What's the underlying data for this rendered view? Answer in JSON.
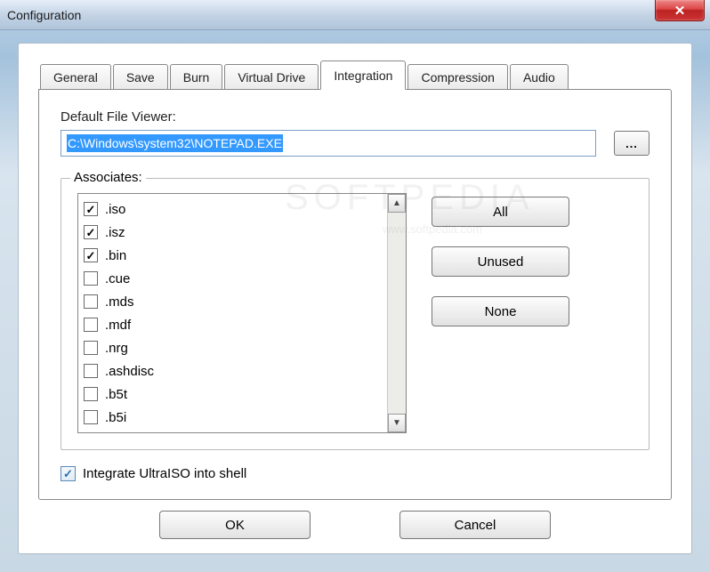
{
  "window": {
    "title": "Configuration",
    "close": "✕"
  },
  "tabs": [
    {
      "label": "General",
      "active": false
    },
    {
      "label": "Save",
      "active": false
    },
    {
      "label": "Burn",
      "active": false
    },
    {
      "label": "Virtual Drive",
      "active": false
    },
    {
      "label": "Integration",
      "active": true
    },
    {
      "label": "Compression",
      "active": false
    },
    {
      "label": "Audio",
      "active": false
    }
  ],
  "integration": {
    "viewer_label": "Default File Viewer:",
    "viewer_value": "C:\\Windows\\system32\\NOTEPAD.EXE",
    "browse_label": "...",
    "associates_label": "Associates:",
    "associates": [
      {
        "ext": ".iso",
        "checked": true
      },
      {
        "ext": ".isz",
        "checked": true
      },
      {
        "ext": ".bin",
        "checked": true
      },
      {
        "ext": ".cue",
        "checked": false
      },
      {
        "ext": ".mds",
        "checked": false
      },
      {
        "ext": ".mdf",
        "checked": false
      },
      {
        "ext": ".nrg",
        "checked": false
      },
      {
        "ext": ".ashdisc",
        "checked": false
      },
      {
        "ext": ".b5t",
        "checked": false
      },
      {
        "ext": ".b5i",
        "checked": false
      }
    ],
    "buttons": {
      "all": "All",
      "unused": "Unused",
      "none": "None"
    },
    "shell_integrate": {
      "label": "Integrate UltraISO into shell",
      "checked": true
    }
  },
  "dialog_buttons": {
    "ok": "OK",
    "cancel": "Cancel"
  },
  "watermark": {
    "main": "SOFTPEDIA",
    "sub": "www.softpedia.com"
  }
}
